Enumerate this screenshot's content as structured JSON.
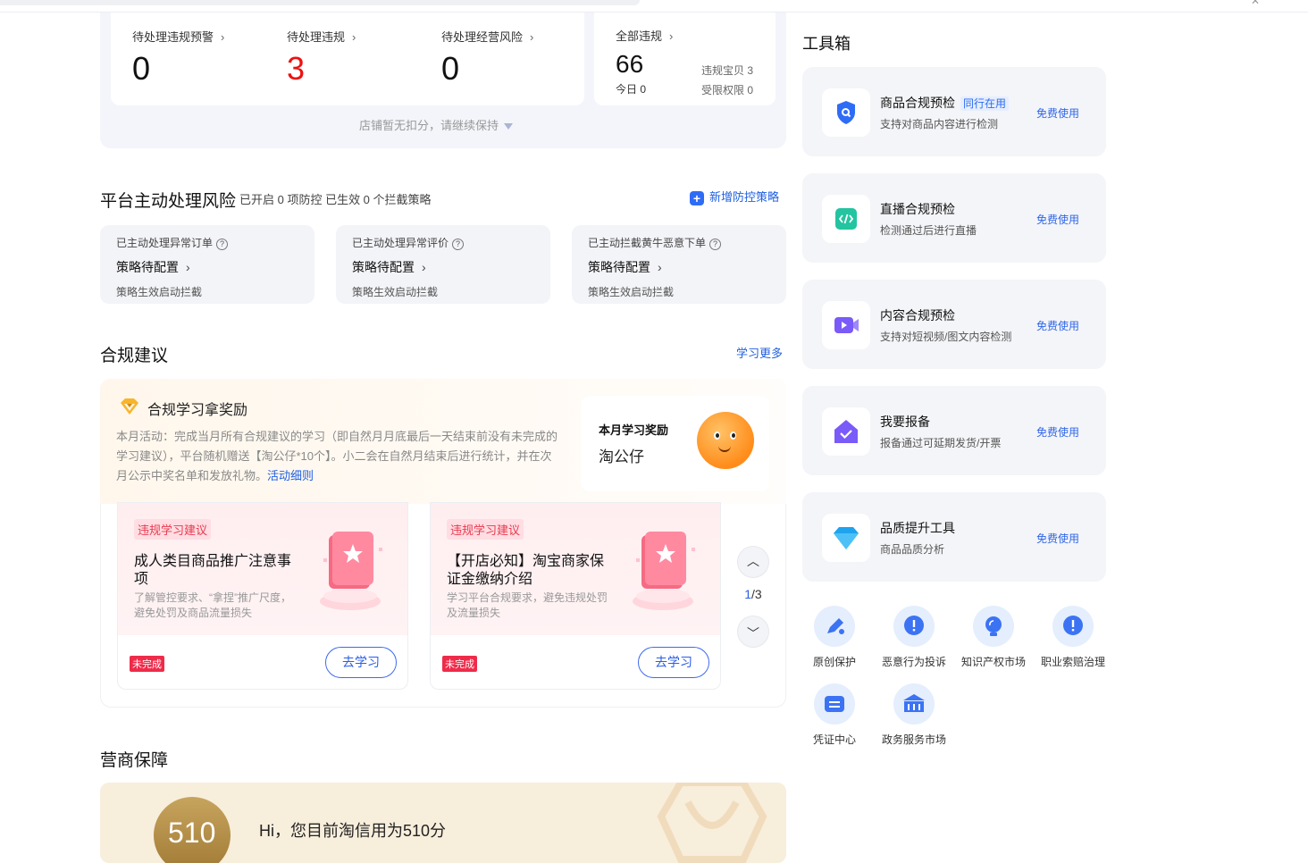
{
  "stats": {
    "pending_warning": {
      "label": "待处理违规预警",
      "value": "0"
    },
    "pending_violation": {
      "label": "待处理违规",
      "value": "3"
    },
    "pending_risk": {
      "label": "待处理经营风险",
      "value": "0"
    },
    "all_violation": {
      "label": "全部违规",
      "value": "66",
      "today": "今日 0",
      "items": "违规宝贝 3",
      "rights": "受限权限 0"
    },
    "footnote": "店铺暂无扣分，请继续保持"
  },
  "platform_risk": {
    "title": "平台主动处理风险",
    "sub": "已开启 0 项防控 已生效 0 个拦截策略",
    "add_link": "新增防控策略",
    "cards": [
      {
        "t1": "已主动处理异常订单",
        "t2": "策略待配置",
        "t3": "策略生效启动拦截"
      },
      {
        "t1": "已主动处理异常评价",
        "t2": "策略待配置",
        "t3": "策略生效启动拦截"
      },
      {
        "t1": "已主动拦截黄牛恶意下单",
        "t2": "策略待配置",
        "t3": "策略生效启动拦截"
      }
    ]
  },
  "compliance": {
    "title": "合规建议",
    "more": "学习更多",
    "reward_title": "合规学习拿奖励",
    "reward_desc": "本月活动：完成当月所有合规建议的学习（即自然月月底最后一天结束前没有未完成的学习建议），平台随机赠送【淘公仔*10个】。小二会在自然月结束后进行统计，并在次月公示中奖名单和发放礼物。",
    "reward_link": "活动细则",
    "reward_card_title": "本月学习奖励",
    "reward_card_item": "淘公仔",
    "cards": [
      {
        "tag": "违规学习建议",
        "title": "成人类目商品推广注意事项",
        "desc": "了解管控要求、“拿捏”推广尺度，避免处罚及商品流量损失",
        "status": "未完成",
        "button": "去学习"
      },
      {
        "tag": "违规学习建议",
        "title": "【开店必知】淘宝商家保证金缴纳介绍",
        "desc": "学习平台合规要求，避免违规处罚及流量损失",
        "status": "未完成",
        "button": "去学习"
      }
    ],
    "pager_current": "1",
    "pager_total": "/3"
  },
  "business": {
    "title": "营商保障",
    "score": "510",
    "text": "Hi，您目前淘信用为510分"
  },
  "toolbox": {
    "title": "工具箱",
    "tools": [
      {
        "name": "商品合规预检",
        "tag": "同行在用",
        "desc": "支持对商品内容进行检测",
        "free": "免费使用",
        "icon": "shield-search-icon",
        "color": "#2f6cf6"
      },
      {
        "name": "直播合规预检",
        "tag": "",
        "desc": "检测通过后进行直播",
        "free": "免费使用",
        "icon": "code-icon",
        "color": "#23c4a0"
      },
      {
        "name": "内容合规预检",
        "tag": "",
        "desc": "支持对短视频/图文内容检测",
        "free": "免费使用",
        "icon": "video-icon",
        "color": "#7a5af8"
      },
      {
        "name": "我要报备",
        "tag": "",
        "desc": "报备通过可延期发货/开票",
        "free": "免费使用",
        "icon": "house-check-icon",
        "color": "#7a5af8"
      },
      {
        "name": "品质提升工具",
        "tag": "",
        "desc": "商品品质分析",
        "free": "免费使用",
        "icon": "diamond-icon",
        "color": "#1ea3ee"
      }
    ],
    "quick": [
      {
        "label": "原创保护",
        "icon": "pen-icon"
      },
      {
        "label": "恶意行为投诉",
        "icon": "alert-chat-icon"
      },
      {
        "label": "知识产权市场",
        "icon": "bulb-icon"
      },
      {
        "label": "职业索赔治理",
        "icon": "alert-chat-icon"
      },
      {
        "label": "凭证中心",
        "icon": "ticket-icon"
      },
      {
        "label": "政务服务市场",
        "icon": "building-icon"
      }
    ]
  }
}
